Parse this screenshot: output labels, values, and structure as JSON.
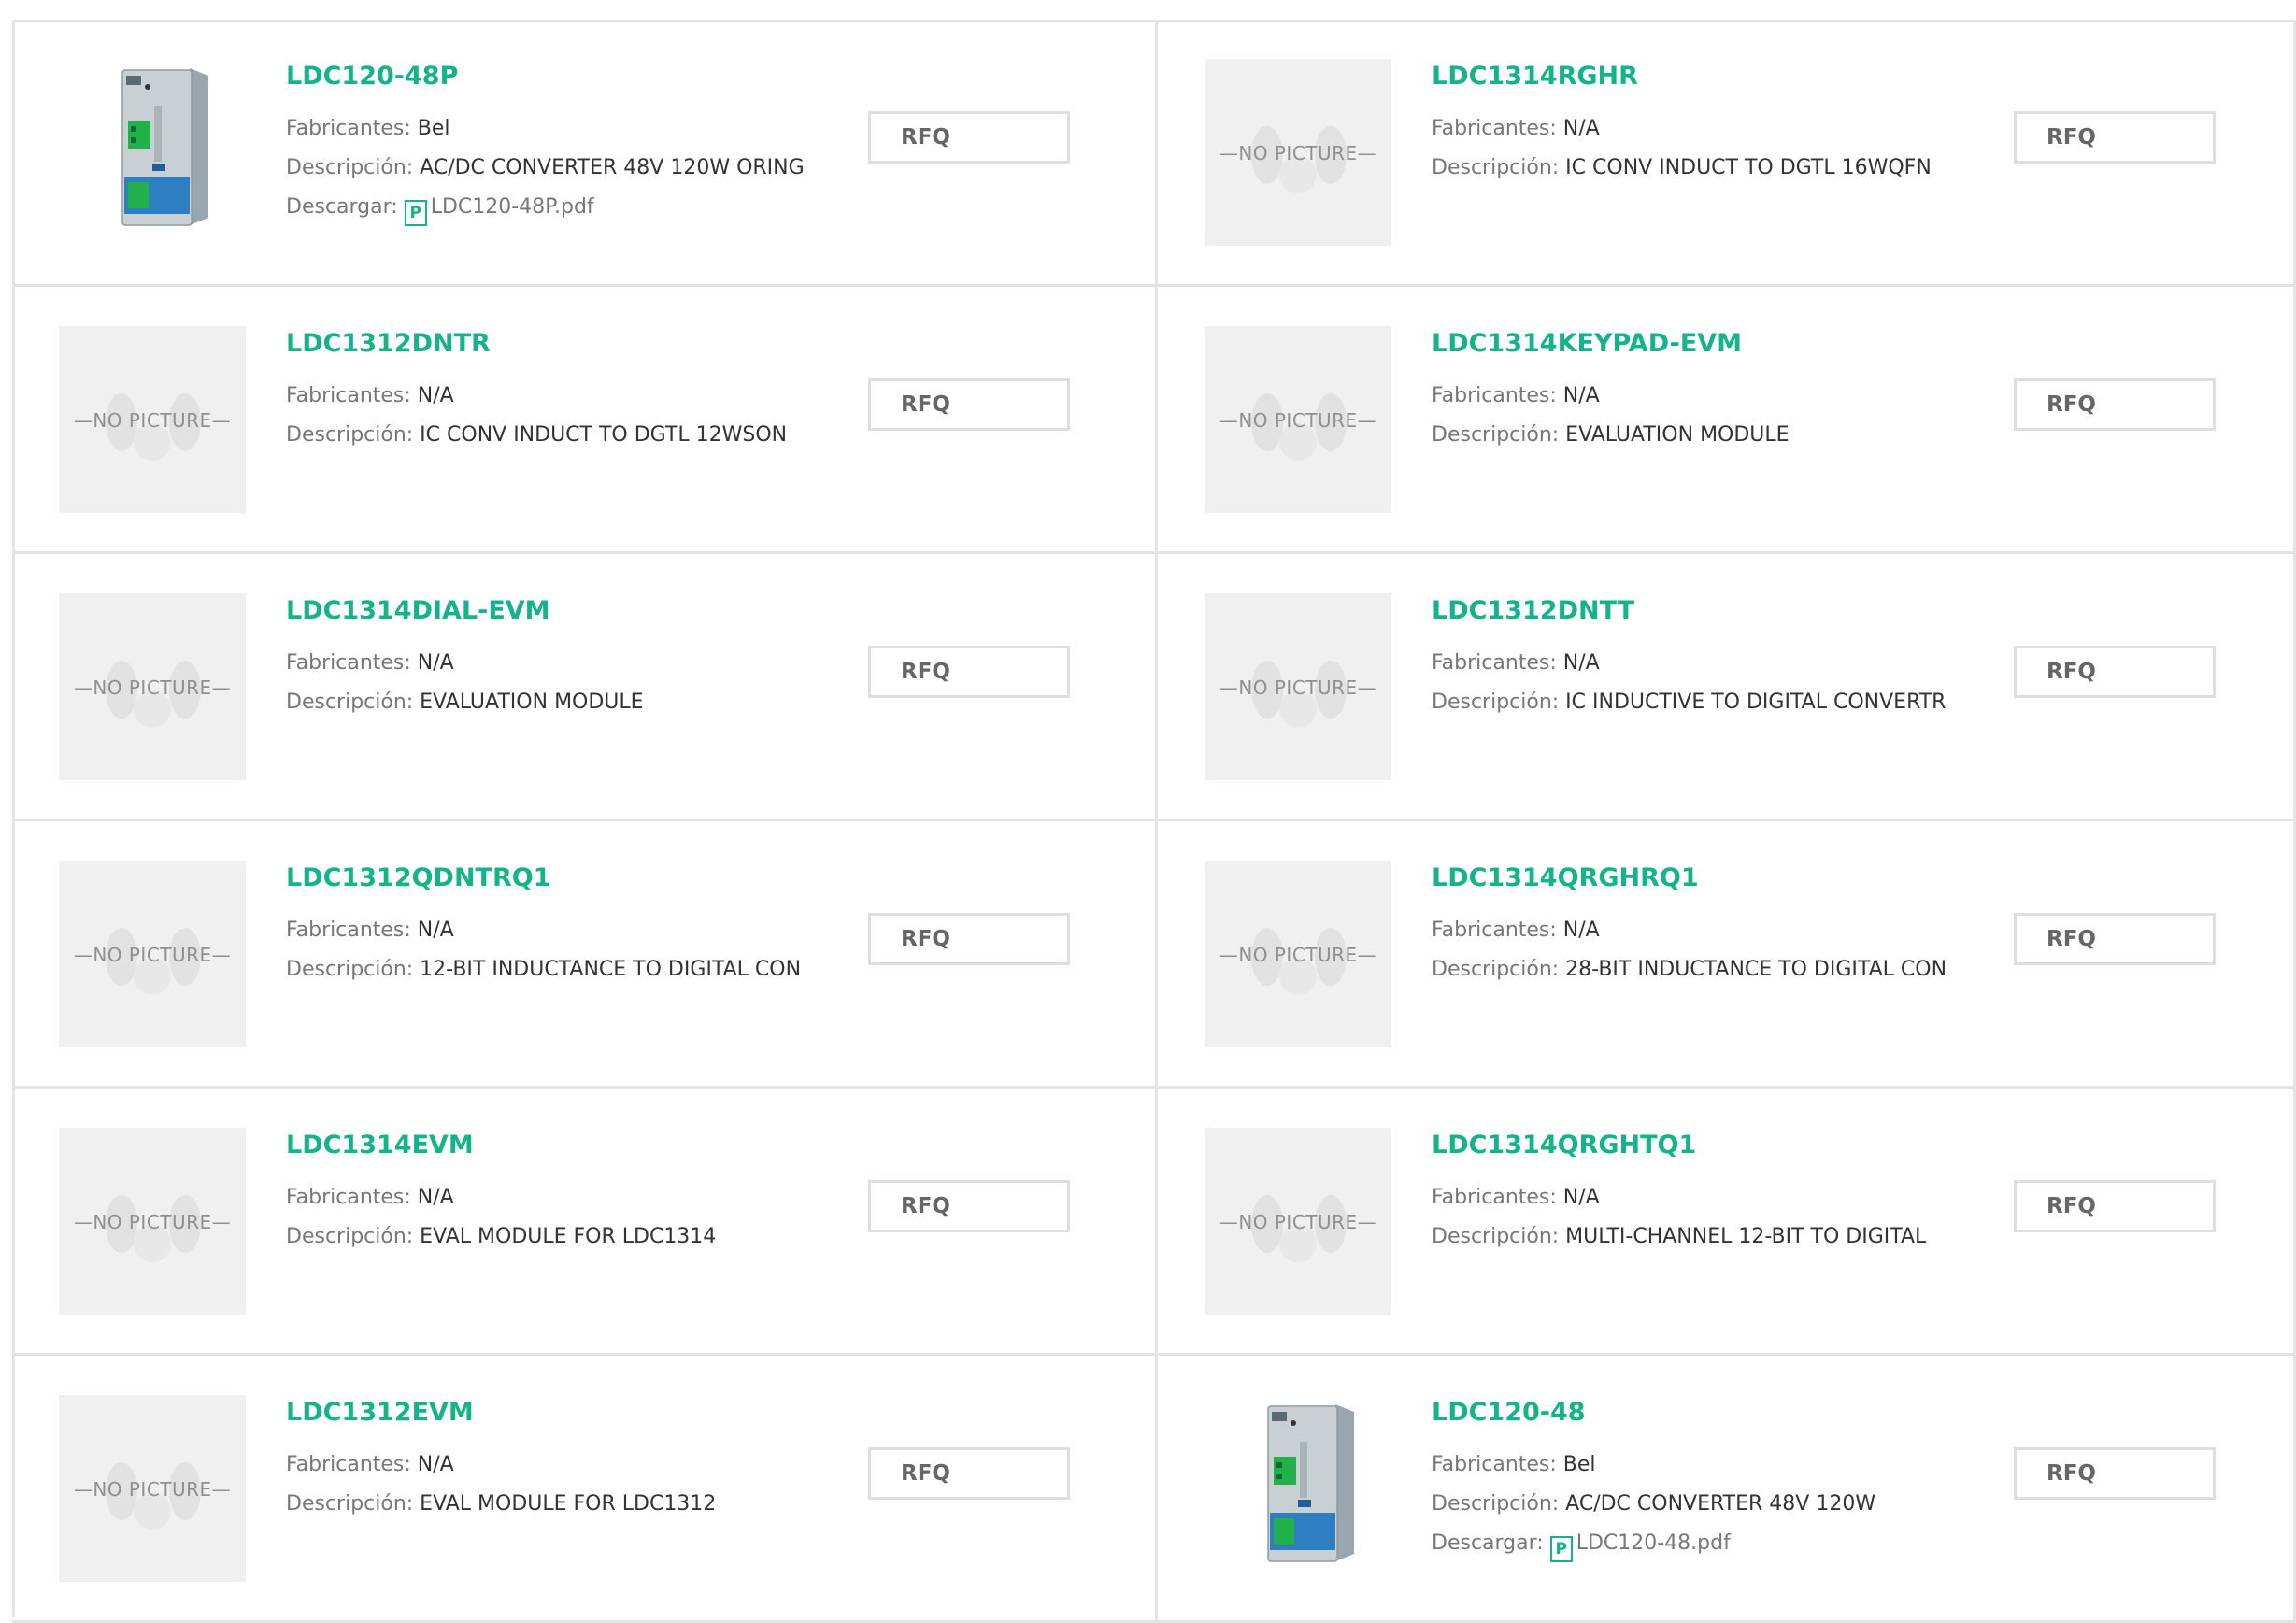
{
  "labels": {
    "manufacturer": "Fabricantes: ",
    "description": "Descripción: ",
    "download": "Descargar: "
  },
  "no_picture_text": "—NO PICTURE—",
  "pdf_icon_glyph": "P",
  "rfq_label": "RFQ",
  "colors": {
    "accent": "#14b48a",
    "border": "#e4e4e4",
    "label": "#777777",
    "value": "#333333"
  },
  "products": [
    {
      "part": "LDC120-48P",
      "manufacturer": "Bel",
      "description": "AC/DC CONVERTER 48V 120W ORING",
      "download": "LDC120-48P.pdf",
      "has_photo": true
    },
    {
      "part": "LDC1314RGHR",
      "manufacturer": "N/A",
      "description": "IC CONV INDUCT TO DGTL 16WQFN",
      "download": null,
      "has_photo": false
    },
    {
      "part": "LDC1312DNTR",
      "manufacturer": "N/A",
      "description": "IC CONV INDUCT TO DGTL 12WSON",
      "download": null,
      "has_photo": false
    },
    {
      "part": "LDC1314KEYPAD-EVM",
      "manufacturer": "N/A",
      "description": "EVALUATION MODULE",
      "download": null,
      "has_photo": false
    },
    {
      "part": "LDC1314DIAL-EVM",
      "manufacturer": "N/A",
      "description": "EVALUATION MODULE",
      "download": null,
      "has_photo": false
    },
    {
      "part": "LDC1312DNTT",
      "manufacturer": "N/A",
      "description": "IC INDUCTIVE TO DIGITAL CONVERTR",
      "download": null,
      "has_photo": false
    },
    {
      "part": "LDC1312QDNTRQ1",
      "manufacturer": "N/A",
      "description": "12-BIT INDUCTANCE TO DIGITAL CON",
      "download": null,
      "has_photo": false
    },
    {
      "part": "LDC1314QRGHRQ1",
      "manufacturer": "N/A",
      "description": "28-BIT INDUCTANCE TO DIGITAL CON",
      "download": null,
      "has_photo": false
    },
    {
      "part": "LDC1314EVM",
      "manufacturer": "N/A",
      "description": "EVAL MODULE FOR LDC1314",
      "download": null,
      "has_photo": false
    },
    {
      "part": "LDC1314QRGHTQ1",
      "manufacturer": "N/A",
      "description": "MULTI-CHANNEL 12-BIT TO DIGITAL",
      "download": null,
      "has_photo": false
    },
    {
      "part": "LDC1312EVM",
      "manufacturer": "N/A",
      "description": "EVAL MODULE FOR LDC1312",
      "download": null,
      "has_photo": false
    },
    {
      "part": "LDC120-48",
      "manufacturer": "Bel",
      "description": "AC/DC CONVERTER 48V 120W",
      "download": "LDC120-48.pdf",
      "has_photo": true
    }
  ]
}
